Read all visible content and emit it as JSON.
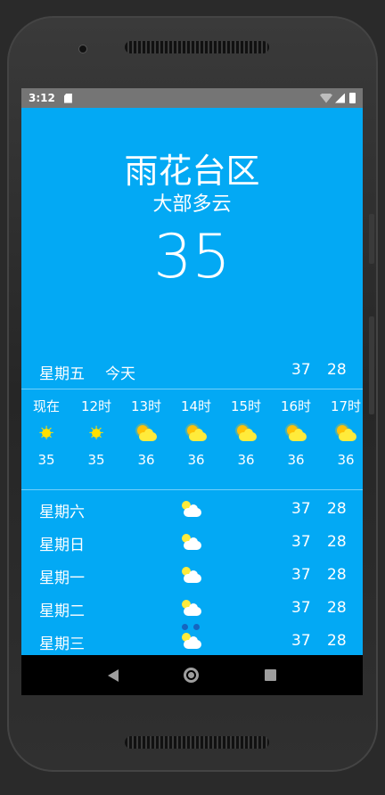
{
  "status_bar": {
    "time": "3:12"
  },
  "weather": {
    "city": "雨花台区",
    "condition": "大部多云",
    "current_temp": "35"
  },
  "today": {
    "day": "星期五",
    "label": "今天",
    "high": "37",
    "low": "28"
  },
  "hourly": [
    {
      "time": "现在",
      "icon": "sunny-icon",
      "temp": "35"
    },
    {
      "time": "12时",
      "icon": "sunny-icon",
      "temp": "35"
    },
    {
      "time": "13时",
      "icon": "partly-cloudy-icon",
      "temp": "36"
    },
    {
      "time": "14时",
      "icon": "partly-cloudy-icon",
      "temp": "36"
    },
    {
      "time": "15时",
      "icon": "partly-cloudy-icon",
      "temp": "36"
    },
    {
      "time": "16时",
      "icon": "partly-cloudy-icon",
      "temp": "36"
    },
    {
      "time": "17时",
      "icon": "partly-cloudy-icon",
      "temp": "36"
    }
  ],
  "daily": [
    {
      "day": "星期六",
      "icon": "partly-cloudy-icon",
      "high": "37",
      "low": "28"
    },
    {
      "day": "星期日",
      "icon": "partly-cloudy-icon",
      "high": "37",
      "low": "28"
    },
    {
      "day": "星期一",
      "icon": "partly-cloudy-icon",
      "high": "37",
      "low": "28"
    },
    {
      "day": "星期二",
      "icon": "partly-cloudy-icon",
      "high": "37",
      "low": "28"
    },
    {
      "day": "星期三",
      "icon": "partly-cloudy-icon",
      "high": "37",
      "low": "28"
    }
  ],
  "colors": {
    "background": "#03a9f4",
    "status_bar": "#757575",
    "nav_bar": "#000000",
    "sun": "#ffe000"
  }
}
